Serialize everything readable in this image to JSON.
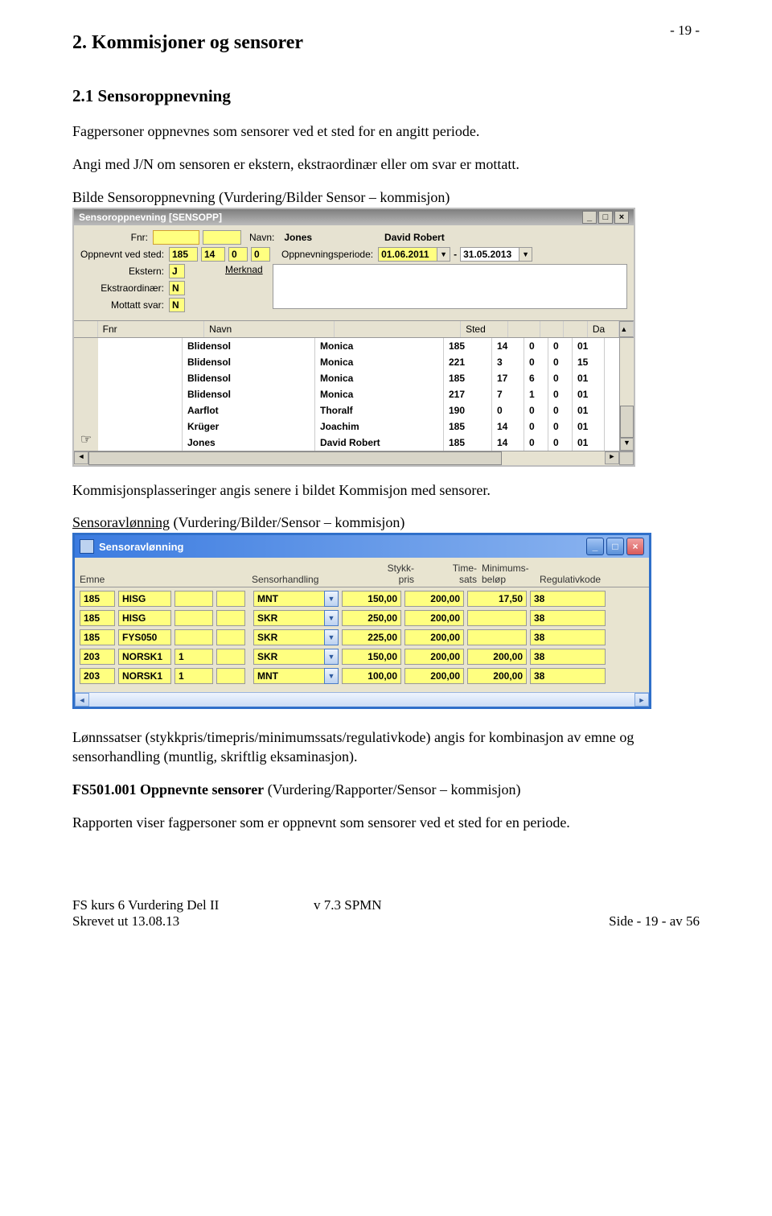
{
  "page": {
    "top_number": "- 19 -",
    "section_title": "2. Kommisjoner og sensorer",
    "subsection_title": "2.1 Sensoroppnevning",
    "intro_p1": "Fagpersoner oppnevnes som sensorer ved et sted for en angitt periode.",
    "intro_p2": "Angi med J/N om sensoren er ekstern, ekstraordinær eller om svar er mottatt.",
    "caption1": "Bilde Sensoroppnevning (Vurdering/Bilder Sensor – kommisjon)",
    "mid_p1": "Kommisjonsplasseringer angis senere i bildet Kommisjon med sensorer.",
    "caption2_prefix": "Sensoravlønning",
    "caption2_rest": " (Vurdering/Bilder/Sensor – kommisjon)",
    "after_p1": "Lønnssatser (stykkpris/timepris/minimumssats/regulativkode) angis for kombinasjon av emne og sensorhandling (muntlig, skriftlig eksaminasjon).",
    "after_p2_bold": "FS501.001 Oppnevnte sensorer",
    "after_p2_rest": " (Vurdering/Rapporter/Sensor – kommisjon)",
    "after_p3": "Rapporten viser fagpersoner som er oppnevnt som sensorer ved et sted for en periode."
  },
  "win1": {
    "title": "Sensoroppnevning  [SENSOPP]",
    "labels": {
      "fnr": "Fnr:",
      "navn": "Navn:",
      "oppnevnt": "Oppnevnt ved sted:",
      "periode": "Oppnevningsperiode:",
      "ekstern": "Ekstern:",
      "ekstra": "Ekstraordinær:",
      "mottatt": "Mottatt svar:",
      "merknad": "Merknad"
    },
    "values": {
      "navn1": "Jones",
      "navn2": "David Robert",
      "sted1": "185",
      "sted2": "14",
      "sted3": "0",
      "sted4": "0",
      "periode_fra": "01.06.2011",
      "periode_sep": "-",
      "periode_til": "31.05.2013",
      "ekstern": "J",
      "ekstra": "N",
      "mottatt": "N"
    },
    "grid_headers": {
      "fnr": "Fnr",
      "navn": "Navn",
      "sted": "Sted",
      "da": "Da"
    },
    "rows": [
      {
        "navn": "Blidensol",
        "fornavn": "Monica",
        "s1": "185",
        "s2": "14",
        "s3": "0",
        "s4": "0",
        "da": "01"
      },
      {
        "navn": "Blidensol",
        "fornavn": "Monica",
        "s1": "221",
        "s2": "3",
        "s3": "0",
        "s4": "0",
        "da": "15"
      },
      {
        "navn": "Blidensol",
        "fornavn": "Monica",
        "s1": "185",
        "s2": "17",
        "s3": "6",
        "s4": "0",
        "da": "01"
      },
      {
        "navn": "Blidensol",
        "fornavn": "Monica",
        "s1": "217",
        "s2": "7",
        "s3": "1",
        "s4": "0",
        "da": "01"
      },
      {
        "navn": "Aarflot",
        "fornavn": "Thoralf",
        "s1": "190",
        "s2": "0",
        "s3": "0",
        "s4": "0",
        "da": "01"
      },
      {
        "navn": "Krüger",
        "fornavn": "Joachim",
        "s1": "185",
        "s2": "14",
        "s3": "0",
        "s4": "0",
        "da": "01"
      },
      {
        "navn": "Jones",
        "fornavn": "David Robert",
        "s1": "185",
        "s2": "14",
        "s3": "0",
        "s4": "0",
        "da": "01"
      }
    ]
  },
  "win2": {
    "title": "Sensoravlønning",
    "headers": {
      "emne": "Emne",
      "sh": "Sensorhandling",
      "stykk": "Stykk-\npris",
      "time": "Time-\nsats",
      "min": "Minimums-\nbeløp",
      "reg": "Regulativkode"
    },
    "rows": [
      {
        "c1": "185",
        "c2": "HISG",
        "c3": "",
        "c4": "",
        "sh": "MNT",
        "stykk": "150,00",
        "time": "200,00",
        "min": "17,50",
        "reg": "38"
      },
      {
        "c1": "185",
        "c2": "HISG",
        "c3": "",
        "c4": "",
        "sh": "SKR",
        "stykk": "250,00",
        "time": "200,00",
        "min": "",
        "reg": "38"
      },
      {
        "c1": "185",
        "c2": "FYS050",
        "c3": "",
        "c4": "",
        "sh": "SKR",
        "stykk": "225,00",
        "time": "200,00",
        "min": "",
        "reg": "38"
      },
      {
        "c1": "203",
        "c2": "NORSK1",
        "c3": "1",
        "c4": "",
        "sh": "SKR",
        "stykk": "150,00",
        "time": "200,00",
        "min": "200,00",
        "reg": "38"
      },
      {
        "c1": "203",
        "c2": "NORSK1",
        "c3": "1",
        "c4": "",
        "sh": "MNT",
        "stykk": "100,00",
        "time": "200,00",
        "min": "200,00",
        "reg": "38"
      }
    ]
  },
  "footer": {
    "line1": "FS kurs 6 Vurdering Del II",
    "line2": "Skrevet ut 13.08.13",
    "version": "v 7.3 SPMN",
    "page": "Side - 19 - av 56"
  }
}
